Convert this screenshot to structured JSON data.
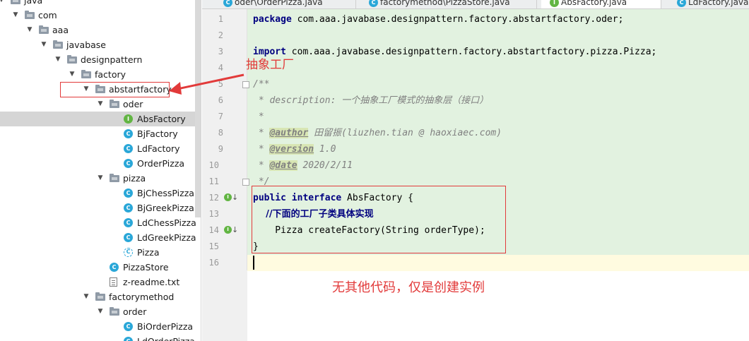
{
  "tree": {
    "items": [
      {
        "label": "java",
        "icon": "folder-icon",
        "expanded": true
      },
      {
        "label": "com",
        "icon": "folder-icon",
        "expanded": true
      },
      {
        "label": "aaa",
        "icon": "folder-icon",
        "expanded": true
      },
      {
        "label": "javabase",
        "icon": "folder-icon",
        "expanded": true
      },
      {
        "label": "designpattern",
        "icon": "folder-icon",
        "expanded": true
      },
      {
        "label": "factory",
        "icon": "folder-icon",
        "expanded": true
      },
      {
        "label": "abstartfactory",
        "icon": "folder-icon",
        "expanded": true
      },
      {
        "label": "oder",
        "icon": "folder-icon",
        "expanded": true
      },
      {
        "label": "AbsFactory",
        "icon": "interface-icon",
        "selected": true
      },
      {
        "label": "BjFactory",
        "icon": "class-icon"
      },
      {
        "label": "LdFactory",
        "icon": "class-icon"
      },
      {
        "label": "OrderPizza",
        "icon": "class-icon"
      },
      {
        "label": "pizza",
        "icon": "folder-icon",
        "expanded": true
      },
      {
        "label": "BjChessPizza",
        "icon": "class-icon"
      },
      {
        "label": "BjGreekPizza",
        "icon": "class-icon"
      },
      {
        "label": "LdChessPizza",
        "icon": "class-icon"
      },
      {
        "label": "LdGreekPizza",
        "icon": "class-icon"
      },
      {
        "label": "Pizza",
        "icon": "abstract-class-icon"
      },
      {
        "label": "PizzaStore",
        "icon": "class-icon"
      },
      {
        "label": "z-readme.txt",
        "icon": "text-file-icon"
      },
      {
        "label": "factorymethod",
        "icon": "folder-icon",
        "expanded": true
      },
      {
        "label": "order",
        "icon": "folder-icon",
        "expanded": true
      },
      {
        "label": "BiOrderPizza",
        "icon": "class-icon"
      },
      {
        "label": "LdOrderPizza",
        "icon": "class-icon"
      }
    ]
  },
  "tabs": [
    {
      "label": "oder\\OrderPizza.java",
      "icon": "class-icon",
      "active": false
    },
    {
      "label": "factorymethod\\PizzaStore.java",
      "icon": "class-icon",
      "active": false
    },
    {
      "label": "AbsFactory.java",
      "icon": "interface-icon",
      "active": true
    },
    {
      "label": "LdFactory.java",
      "icon": "class-icon",
      "active": false
    }
  ],
  "editor": {
    "line_numbers": [
      "1",
      "2",
      "3",
      "4",
      "5",
      "6",
      "7",
      "8",
      "9",
      "10",
      "11",
      "12",
      "13",
      "14",
      "15",
      "16"
    ],
    "line1": {
      "kw": "package",
      "rest": " com.aaa.javabase.designpattern.factory.abstartfactory.oder;"
    },
    "line3": {
      "kw": "import",
      "rest": " com.aaa.javabase.designpattern.factory.abstartfactory.pizza.Pizza;"
    },
    "line5": "/**",
    "line6": " * description: 一个抽象工厂模式的抽象层（接口）",
    "line7": " *",
    "line8": {
      "prefix": " * ",
      "tag": "@author",
      "rest": " 田留振(liuzhen.tian @ haoxiaec.com)"
    },
    "line9": {
      "prefix": " * ",
      "tag": "@version",
      "rest": " 1.0"
    },
    "line10": {
      "prefix": " * ",
      "tag": "@date",
      "rest": " 2020/2/11"
    },
    "line11": " */",
    "line12": {
      "kw": "public interface",
      "rest": " AbsFactory {"
    },
    "line13": "    //下面的工厂子类具体实现",
    "line14": "    Pizza createFactory(String orderType);",
    "line15": "}",
    "line16": ""
  },
  "annotations": {
    "label_abstract_factory": "抽象工厂",
    "note_no_other_code": "无其他代码，仅是创建实例"
  },
  "colors": {
    "annotation_red": "#e23a3a",
    "code_background": "#e2f2e0",
    "interface_icon": "#62b543",
    "class_icon": "#2aa7d8"
  }
}
